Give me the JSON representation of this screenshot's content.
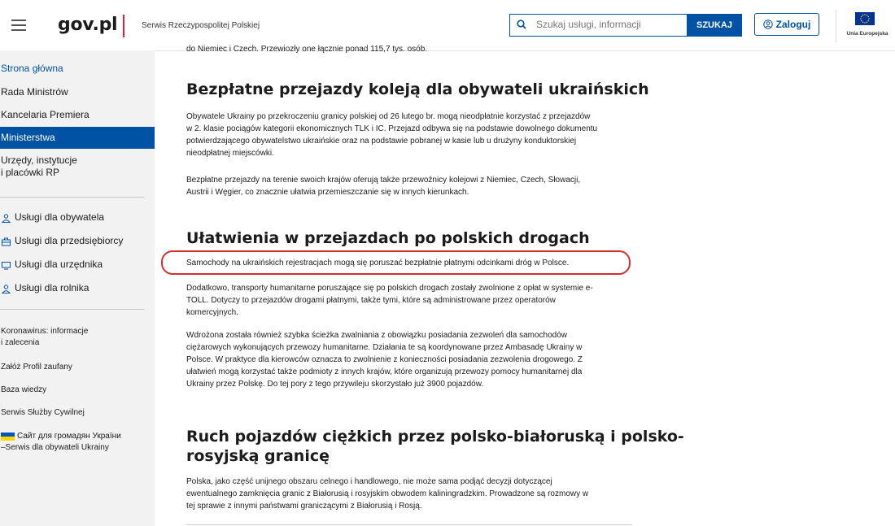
{
  "header": {
    "logo": "gov.pl",
    "service_name": "Serwis Rzeczypospolitej Polskiej",
    "search_placeholder": "Szukaj usługi, informacji",
    "search_button": "SZUKAJ",
    "login_button": "Zaloguj",
    "eu_label": "Unia Europejska",
    "accent_color": "#0052a5",
    "brand_red": "#d4213d"
  },
  "sidebar": {
    "nav": [
      {
        "label": "Strona główna",
        "state": "link"
      },
      {
        "label": "Rada Ministrów",
        "state": "normal"
      },
      {
        "label": "Kancelaria Premiera",
        "state": "normal"
      },
      {
        "label": "Ministerstwa",
        "state": "active"
      },
      {
        "label": "Urzędy, instytucje",
        "label2": "i placówki RP",
        "state": "normal"
      }
    ],
    "services": [
      {
        "label": "Usługi dla obywatela",
        "icon": "person-icon"
      },
      {
        "label": "Usługi dla przedsiębiorcy",
        "icon": "briefcase-icon"
      },
      {
        "label": "Usługi dla urzędnika",
        "icon": "monitor-icon"
      },
      {
        "label": "Usługi dla rolnika",
        "icon": "person-icon"
      }
    ],
    "extras": [
      {
        "label": "Koronawirus: informacje",
        "label2": "i zalecenia"
      },
      {
        "label": "Załóż Profil zaufany"
      },
      {
        "label": "Baza wiedzy"
      },
      {
        "label": "Serwis Służby Cywilnej"
      },
      {
        "label": "Сайт для громадян України",
        "label2": "–Serwis dla obywateli Ukrainy",
        "icon": "ukraine-flag-icon"
      }
    ]
  },
  "article": {
    "top_fragment": "do Niemiec i Czech. Przewiozły one łącznie ponad  115,7 tys. osób.",
    "section1": {
      "title": "Bezpłatne przejazdy koleją dla obywateli ukraińskich",
      "p1": [
        "Obywatele Ukrainy po przekroczeniu granicy polskiej od 26 lutego br. mogą nieodpłatnie korzystać z przejazdów",
        "w 2. klasie pociągów kategorii ekonomicznych TLK i IC. Przejazd odbywa się na podstawie dowolnego dokumentu",
        "potwierdzającego obywatelstwo ukraińskie oraz na podstawie pobranej w kasie lub u drużyny konduktorskiej",
        "nieodpłatnej miejscówki."
      ],
      "p2": [
        "Bezpłatne przejazdy na terenie swoich krajów oferują także przewoźnicy kolejowi z Niemiec, Czech, Słowacji,",
        "Austrii i Węgier, co znacznie ułatwia przemieszczanie się w innych kierunkach."
      ]
    },
    "section2": {
      "title": "Ułatwienia w przejazdach po polskich drogach",
      "highlighted": "Samochody na ukraińskich rejestracjach mogą się poruszać bezpłatnie płatnymi odcinkami dróg w Polsce.",
      "p1": [
        "Dodatkowo, transporty humanitarne poruszające się po polskich drogach zostały zwolnione z opłat w systemie e-",
        "TOLL. Dotyczy to przejazdów drogami płatnymi, także  tymi, które są administrowane przez operatorów",
        "komercyjnych."
      ],
      "p2": [
        "Wdrożona została również szybka ścieżka zwalniania z obowiązku posiadania zezwoleń dla samochodów",
        "ciężarowych wykonujących przewozy humanitarne. Działania te są koordynowane przez  Ambasadę Ukrainy w",
        "Polsce. W praktyce dla kierowców oznacza to zwolnienie z konieczności posiadania zezwolenia drogowego. Z",
        "ułatwień mogą korzystać także podmioty z innych krajów, które organizują przewozy pomocy humanitarnej dla",
        "Ukrainy przez Polskę. Do tej pory z tego przywileju skorzystało już 3900 pojazdów."
      ]
    },
    "section3": {
      "title_line1": "Ruch pojazdów ciężkich przez polsko-białoruską i polsko-",
      "title_line2": "rosyjską granicę",
      "p1": [
        "Polska, jako część unijnego obszaru celnego i handlowego, nie może sama podjąć decyzji dotyczącej",
        "ewentualnego zamknięcia granic z Białorusią i rosyjskim obwodem kaliningradzkim. Prowadzone są rozmowy w",
        "tej sprawie z innymi państwami graniczącymi z Białorusią i Rosją."
      ]
    }
  }
}
